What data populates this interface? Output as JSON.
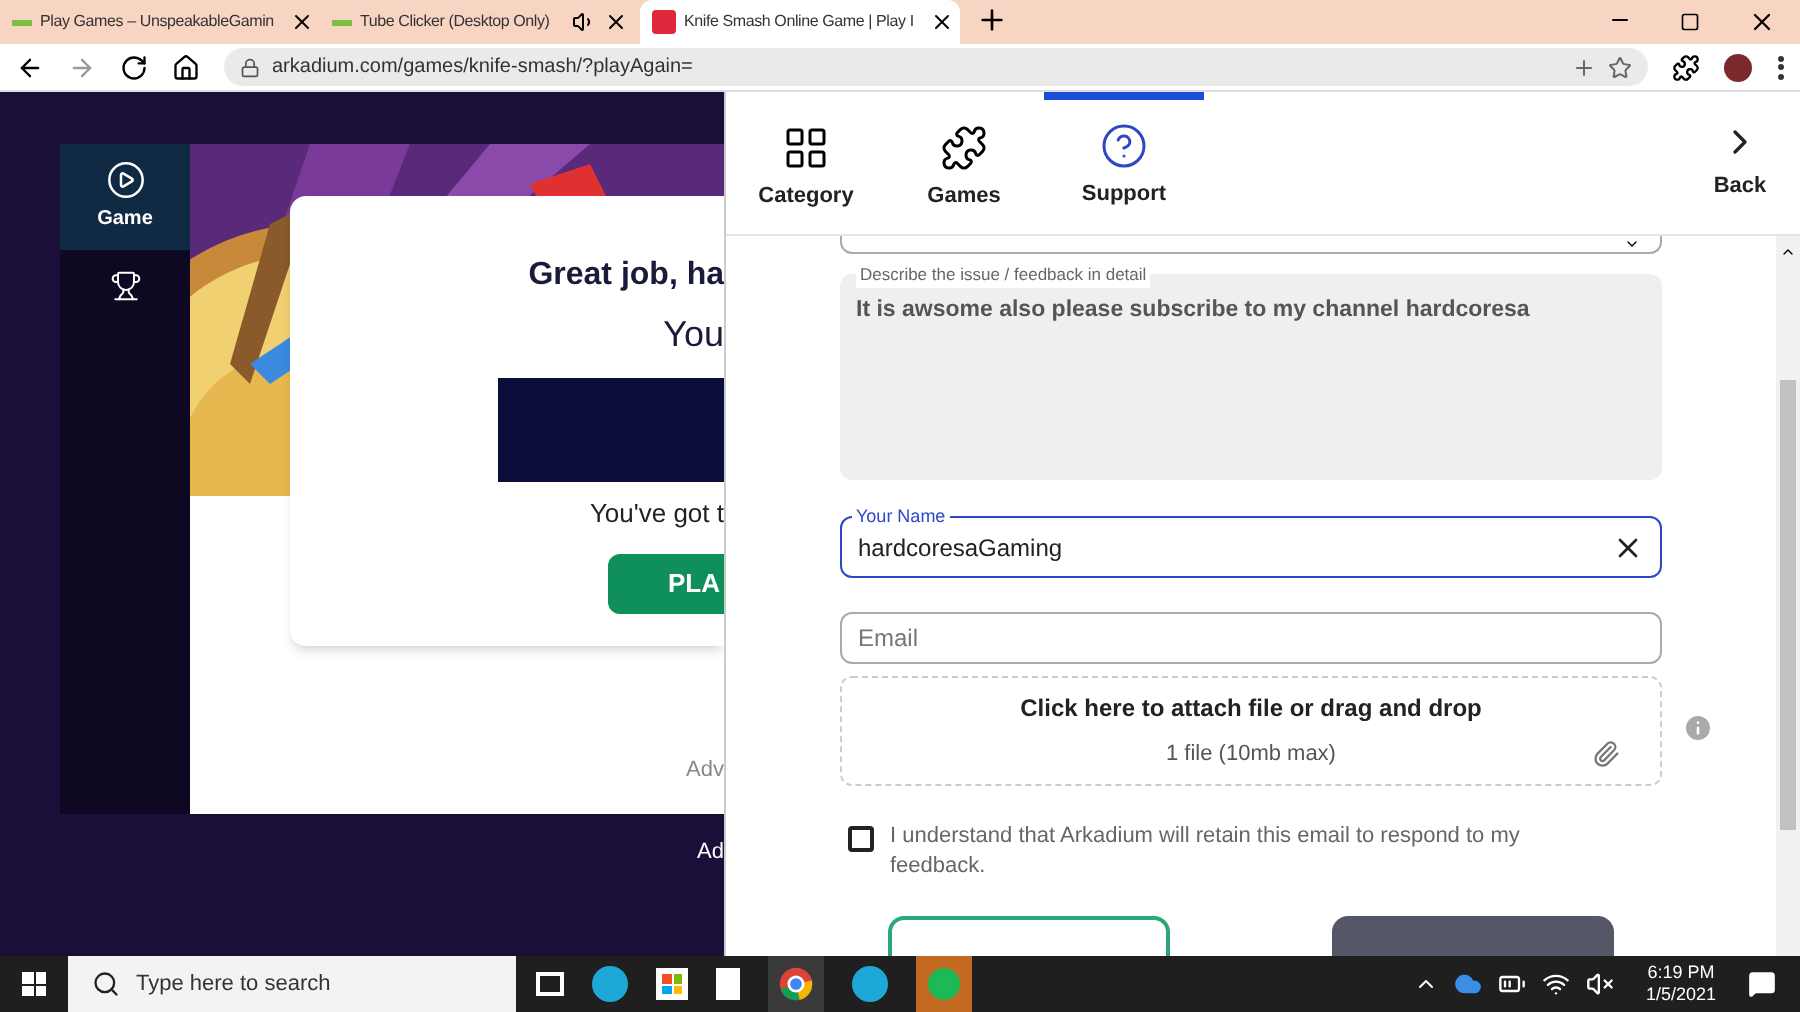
{
  "browser": {
    "tabs": [
      {
        "title": "Play Games – UnspeakableGamin",
        "kind": "site",
        "audio": false,
        "selected": false
      },
      {
        "title": "Tube Clicker (Desktop Only)",
        "kind": "site",
        "audio": true,
        "selected": false
      },
      {
        "title": "Knife Smash Online Game | Play I",
        "kind": "game",
        "audio": false,
        "selected": true
      }
    ],
    "address": "arkadium.com/games/knife-smash/?playAgain="
  },
  "game_sidebar": {
    "items": [
      {
        "kind": "play",
        "label": "Game",
        "selected": true
      },
      {
        "kind": "trophy",
        "selected": false
      }
    ]
  },
  "game_card": {
    "title": "Great job, ha",
    "subtitle": "You",
    "message": "You've got t",
    "button": "PLA",
    "footnote": "Adv"
  },
  "page_footnote": "Ad",
  "panel_nav": {
    "items": [
      {
        "kind": "category",
        "label": "Category",
        "selected": false
      },
      {
        "kind": "games",
        "label": "Games",
        "selected": false
      },
      {
        "kind": "support",
        "label": "Support",
        "selected": true
      }
    ],
    "back": "Back"
  },
  "form": {
    "description": {
      "label": "Describe the issue / feedback in detail",
      "value": "It is awsome also please subscribe to my channel hardcoresa"
    },
    "name": {
      "label": "Your Name",
      "value": "hardcoresaGaming"
    },
    "email": {
      "placeholder": "Email"
    },
    "attach": {
      "title": "Click here to attach file or drag and drop",
      "hint": "1 file (10mb max)"
    },
    "consent": {
      "text": "I understand that Arkadium will retain this email to respond to my feedback.",
      "checked": false
    }
  },
  "taskbar": {
    "search": {
      "placeholder": "Type here to search"
    },
    "time": "6:19 PM",
    "date": "1/5/2021"
  }
}
